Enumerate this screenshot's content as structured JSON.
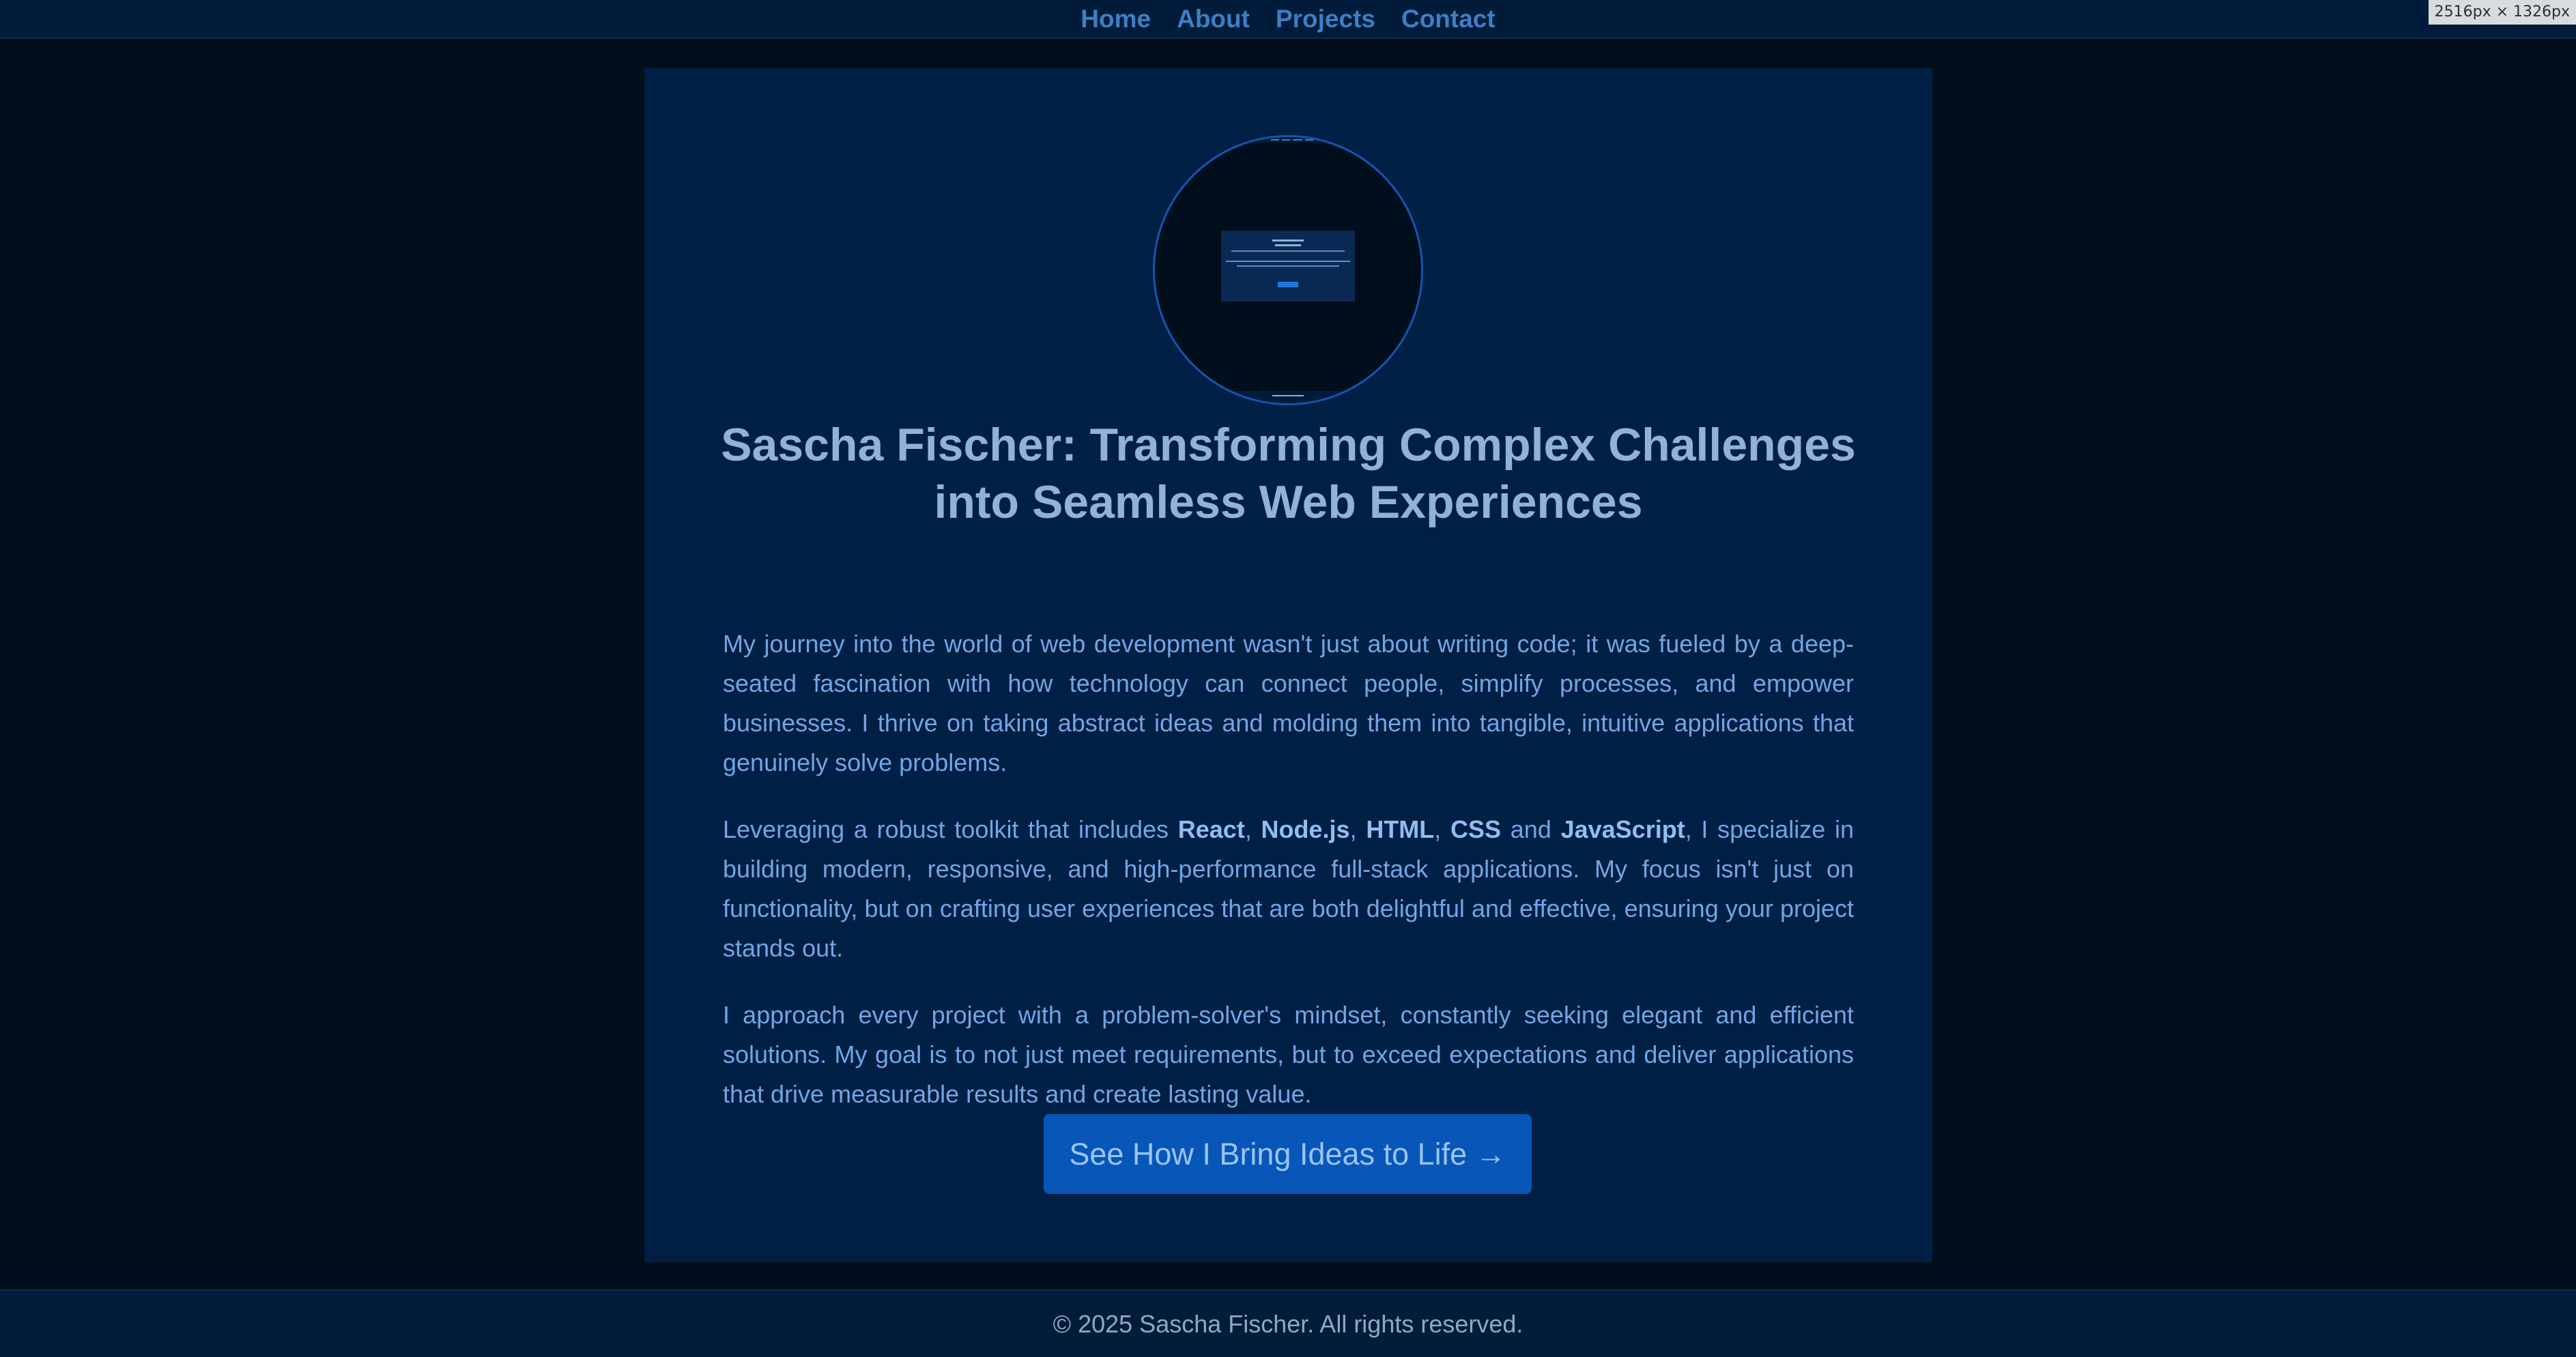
{
  "nav": {
    "items": [
      {
        "label": "Home"
      },
      {
        "label": "About"
      },
      {
        "label": "Projects"
      },
      {
        "label": "Contact"
      }
    ]
  },
  "dimension_badge": "2516px × 1326px",
  "hero": {
    "title": "Sascha Fischer: Transforming Complex Challenges into Seamless Web Experiences",
    "paragraphs": {
      "p1": "My journey into the world of web development wasn't just about writing code; it was fueled by a deep-seated fascination with how technology can connect people, simplify processes, and empower businesses. I thrive on taking abstract ideas and molding them into tangible, intuitive applications that genuinely solve problems.",
      "p2": {
        "intro": "Leveraging a robust toolkit that includes ",
        "skills": [
          "React",
          "Node.js",
          "HTML",
          "CSS",
          "JavaScript"
        ],
        "sep1": ", ",
        "sep2": ", ",
        "sep3": ", ",
        "sep4": " and ",
        "rest": ", I specialize in building modern, responsive, and high-performance full-stack applications. My focus isn't just on functionality, but on crafting user experiences that are both delightful and effective, ensuring your project stands out."
      },
      "p3": "I approach every project with a problem-solver's mindset, constantly seeking elegant and efficient solutions. My goal is to not just meet requirements, but to exceed expectations and deliver applications that drive measurable results and create lasting value."
    },
    "cta_label": "See How I Bring Ideas to Life →"
  },
  "footer": {
    "text": "© 2025 Sascha Fischer. All rights reserved."
  },
  "colors": {
    "background": "#010e1b",
    "nav_bg": "#001c3a",
    "card_bg": "#001f44",
    "accent_button": "#0756b8",
    "link": "#3e7ec4",
    "text": "#71a6e6"
  }
}
